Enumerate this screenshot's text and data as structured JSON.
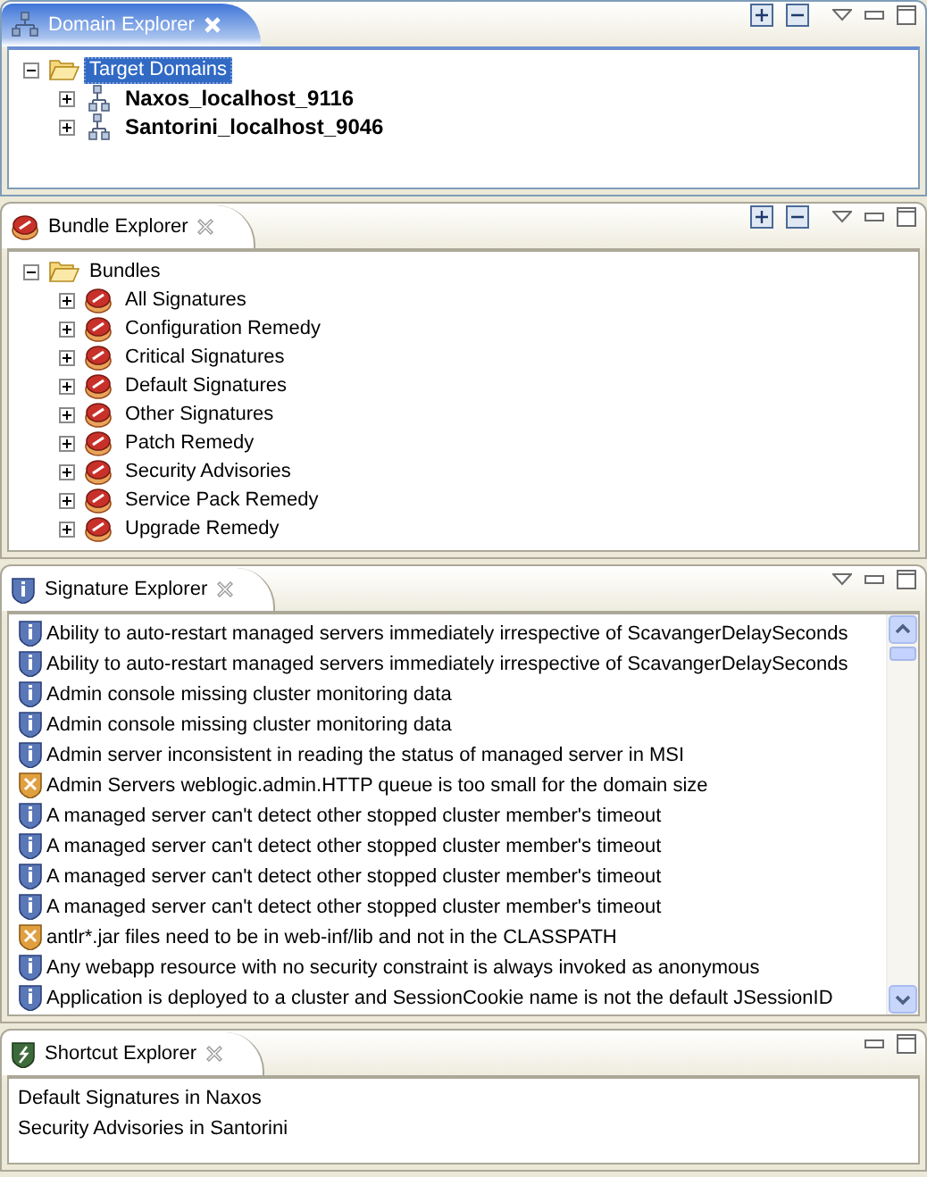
{
  "panels": [
    {
      "title": "Domain Explorer",
      "kind": "tree",
      "active": true,
      "tree": [
        {
          "label": "Target Domains",
          "expanded": true,
          "selected": true,
          "children": [
            {
              "label": "Naxos_localhost_9116",
              "expanded": false,
              "selected": false
            },
            {
              "label": "Santorini_localhost_9046",
              "expanded": false,
              "selected": false
            }
          ]
        }
      ]
    },
    {
      "title": "Bundle Explorer",
      "kind": "tree",
      "active": false,
      "tree": [
        {
          "label": "Bundles",
          "expanded": true,
          "selected": false,
          "children": [
            {
              "label": "All Signatures",
              "expanded": false,
              "selected": false
            },
            {
              "label": "Configuration Remedy",
              "expanded": false,
              "selected": false
            },
            {
              "label": "Critical Signatures",
              "expanded": false,
              "selected": false
            },
            {
              "label": "Default Signatures",
              "expanded": false,
              "selected": false
            },
            {
              "label": "Other Signatures",
              "expanded": false,
              "selected": false
            },
            {
              "label": "Patch Remedy",
              "expanded": false,
              "selected": false
            },
            {
              "label": "Security Advisories",
              "expanded": false,
              "selected": false
            },
            {
              "label": "Service Pack Remedy",
              "expanded": false,
              "selected": false
            },
            {
              "label": "Upgrade Remedy",
              "expanded": false,
              "selected": false
            }
          ]
        }
      ]
    },
    {
      "title": "Signature Explorer",
      "kind": "signatures",
      "active": false,
      "items": [
        {
          "kind": "info",
          "text": "Ability to auto-restart managed servers immediately irrespective of ScavangerDelaySeconds"
        },
        {
          "kind": "info",
          "text": "Ability to auto-restart managed servers immediately irrespective of ScavangerDelaySeconds"
        },
        {
          "kind": "info",
          "text": "Admin console missing cluster monitoring data"
        },
        {
          "kind": "info",
          "text": "Admin console missing cluster monitoring data"
        },
        {
          "kind": "info",
          "text": "Admin server inconsistent in reading the status of managed server in MSI"
        },
        {
          "kind": "warning",
          "text": "Admin Servers weblogic.admin.HTTP queue is too small for the domain size"
        },
        {
          "kind": "info",
          "text": "A managed server can't detect other stopped cluster member's timeout"
        },
        {
          "kind": "info",
          "text": "A managed server can't detect other stopped cluster member's timeout"
        },
        {
          "kind": "info",
          "text": "A managed server can't detect other stopped cluster member's timeout"
        },
        {
          "kind": "info",
          "text": "A managed server can't detect other stopped cluster member's timeout"
        },
        {
          "kind": "warning",
          "text": "antlr*.jar files need to be in web-inf/lib and not in the CLASSPATH"
        },
        {
          "kind": "info",
          "text": "Any webapp resource with no security constraint is always invoked as anonymous"
        },
        {
          "kind": "info",
          "text": "Application is deployed to a cluster and SessionCookie name is not the default JSessionID"
        }
      ]
    },
    {
      "title": "Shortcut Explorer",
      "kind": "shortcuts",
      "active": false,
      "items": [
        {
          "text": "Default Signatures in Naxos"
        },
        {
          "text": "Security Advisories in Santorini"
        }
      ]
    }
  ]
}
